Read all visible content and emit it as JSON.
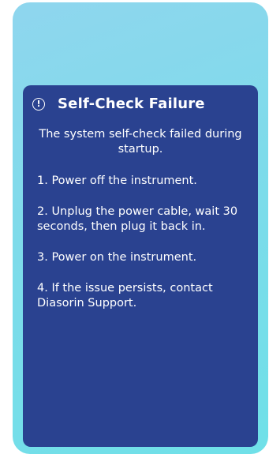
{
  "dialog": {
    "icon": "alert-circle-icon",
    "icon_glyph": "!",
    "title": "Self-Check Failure",
    "summary": "The system self-check failed during startup.",
    "steps": [
      "1. Power off the instrument.",
      "2. Unplug the power cable, wait 30 seconds, then plug it back in.",
      "3. Power on the instrument.",
      "4. If the issue persists, contact Diasorin Support."
    ]
  },
  "colors": {
    "dialog_background": "#2a4290",
    "screen_gradient_start": "#8fd6ee",
    "screen_gradient_end": "#6fe0e8",
    "text": "#ffffff"
  }
}
